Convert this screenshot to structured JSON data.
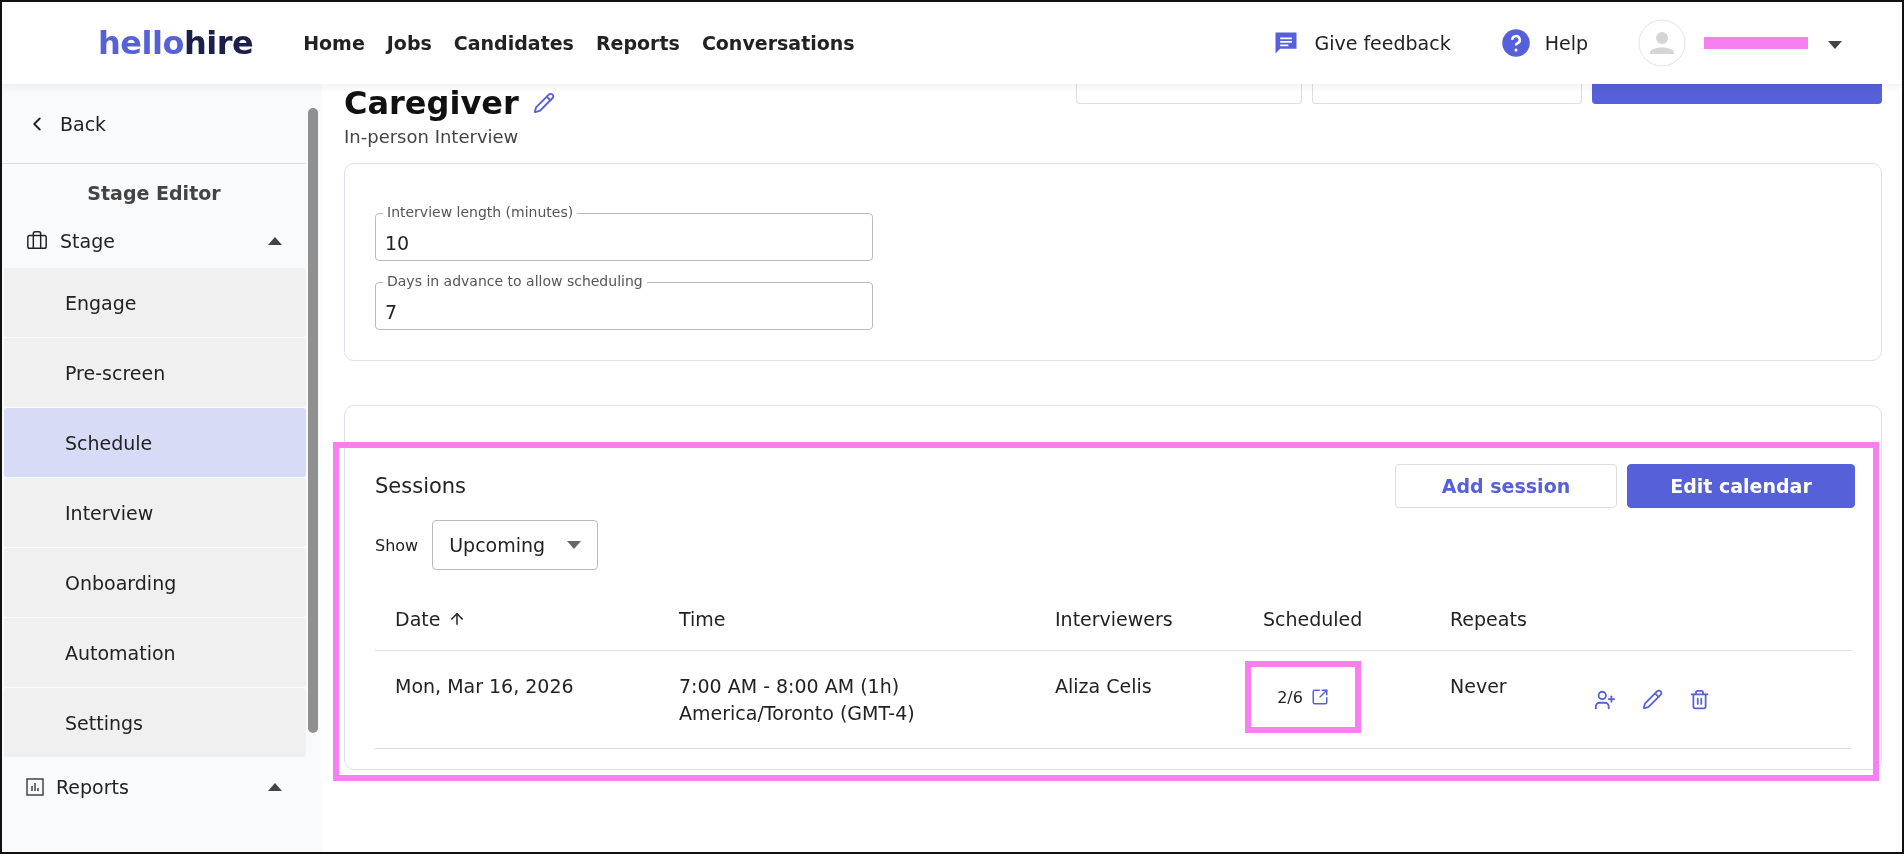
{
  "header": {
    "logo": {
      "lead": "hello",
      "tail": "hire"
    },
    "nav": [
      "Home",
      "Jobs",
      "Candidates",
      "Reports",
      "Conversations"
    ],
    "feedback": "Give feedback",
    "help": "Help",
    "user": {
      "redacted": true
    }
  },
  "sidebar": {
    "back": "Back",
    "title": "Stage Editor",
    "sections": [
      {
        "label": "Stage",
        "kind": "briefcase",
        "expanded": true,
        "items": [
          {
            "label": "Engage",
            "selected": false
          },
          {
            "label": "Pre-screen",
            "selected": false
          },
          {
            "label": "Schedule",
            "selected": true
          },
          {
            "label": "Interview",
            "selected": false
          },
          {
            "label": "Onboarding",
            "selected": false
          },
          {
            "label": "Automation",
            "selected": false
          },
          {
            "label": "Settings",
            "selected": false
          }
        ]
      },
      {
        "label": "Reports",
        "kind": "chart",
        "expanded": true
      }
    ]
  },
  "page": {
    "title": "Caregiver",
    "subtitle": "In-person Interview",
    "actions": [
      {
        "kind": "outline"
      },
      {
        "kind": "outline"
      },
      {
        "kind": "primary"
      }
    ]
  },
  "settings": {
    "fields": [
      {
        "label": "Interview length (minutes)",
        "value": "10"
      },
      {
        "label": "Days in advance to allow scheduling",
        "value": "7"
      }
    ]
  },
  "sessions": {
    "title": "Sessions",
    "highlighted": true,
    "buttons": [
      {
        "label": "Add session",
        "kind": "outline"
      },
      {
        "label": "Edit calendar",
        "kind": "primary"
      }
    ],
    "show_label": "Show",
    "show_value": "Upcoming",
    "columns": [
      "Date",
      "Time",
      "Interviewers",
      "Scheduled",
      "Repeats"
    ],
    "rows": [
      {
        "date": "Mon, Mar 16, 2026",
        "time": "7:00 AM - 8:00 AM (1h)",
        "timezone": "America/Toronto (GMT-4)",
        "interviewers": "Aliza Celis",
        "scheduled": "2/6",
        "scheduled_highlighted": true,
        "repeats": "Never"
      }
    ]
  }
}
